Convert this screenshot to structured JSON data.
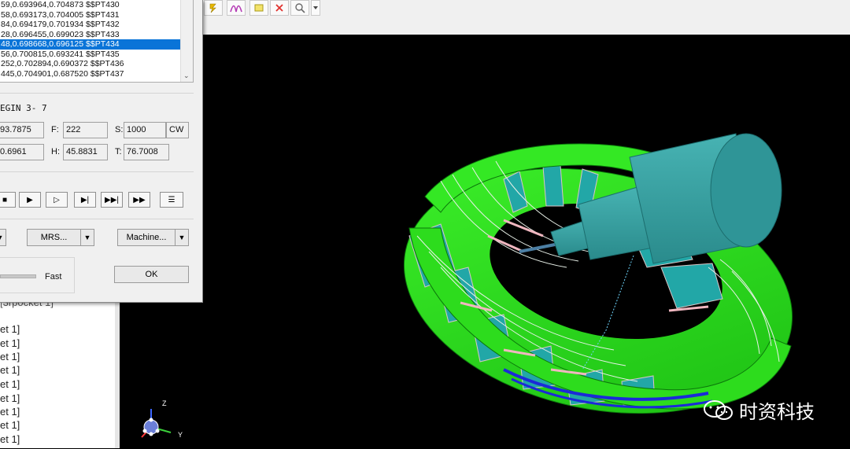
{
  "toolbar": {
    "icons": [
      "bolt-icon",
      "helix-icon",
      "ribbon-icon",
      "star-cut-icon",
      "close-x-icon",
      "magnifier-icon",
      "dropdown-icon"
    ],
    "colors": {
      "bg": "#f0f0f0"
    }
  },
  "dialog": {
    "list_rows": [
      "59,0.693964,0.704873 $$PT430",
      "58,0.693173,0.704005 $$PT431",
      "84,0.694179,0.701934 $$PT432",
      "28,0.696455,0.699023 $$PT433",
      "48,0.698668,0.696125 $$PT434",
      "56,0.700815,0.693241 $$PT435",
      "252,0.702894,0.690372 $$PT436",
      "445,0.704901,0.687520 $$PT437"
    ],
    "selected_row": 4,
    "region_label": "EGIN 3- 7",
    "fields": {
      "x_value": "93.7875",
      "f_label": "F:",
      "f_value": "222",
      "s_label": "S:",
      "s_value": "1000",
      "dir_value": "CW",
      "y_value": "0.6961",
      "h_label": "H:",
      "h_value": "45.8831",
      "t_label": "T:",
      "t_value": "76.7008"
    },
    "playback": {
      "icons": [
        "stop-icon",
        "play-icon",
        "play-small-icon",
        "step-icon",
        "step-fast-icon",
        "skip-end-icon",
        "list-icon"
      ]
    },
    "buttons": {
      "mrs_label": "MRS...",
      "machine_label": "Machine...",
      "ok_label": "OK",
      "fast_label": "Fast"
    }
  },
  "tree": {
    "partial_top": "[3rpocket 1]",
    "items": [
      "et 1]",
      "et 1]",
      "et 1]",
      "et 1]",
      "et 1]",
      "et 1]",
      "et 1]",
      "et 1]",
      "et 1]"
    ]
  },
  "viewport": {
    "colors": {
      "bg": "#000000",
      "blade": "#2cdc1e",
      "tool": "#3a9fa0",
      "hub": "#1d8d8f"
    },
    "axis_labels": {
      "z": "Z",
      "y": "Y"
    }
  },
  "watermark": {
    "text": "时资科技"
  }
}
